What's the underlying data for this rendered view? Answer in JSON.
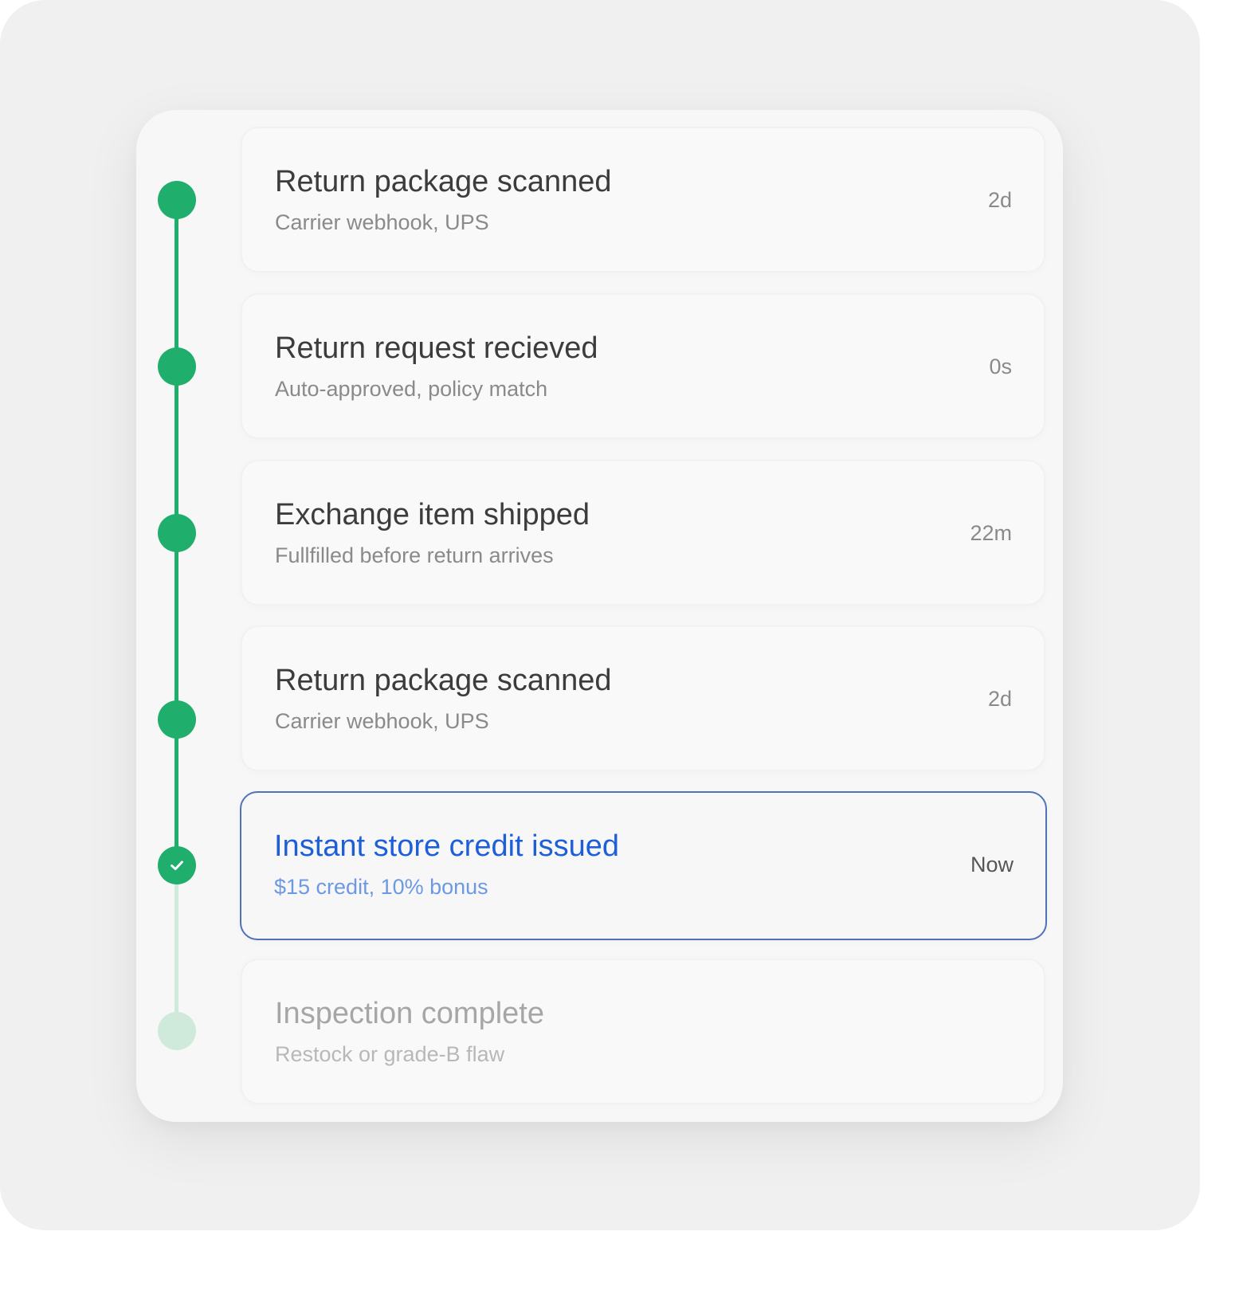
{
  "timeline": {
    "colors": {
      "complete": "#1fae6c",
      "pending": "#cfeadb",
      "active_border": "#4f72b8",
      "active_title": "#1e5fd8"
    },
    "events": [
      {
        "title": "Return package scanned",
        "subtitle": "Carrier webhook, UPS",
        "time": "2d",
        "status": "complete"
      },
      {
        "title": "Return request recieved",
        "subtitle": "Auto-approved, policy match",
        "time": "0s",
        "status": "complete"
      },
      {
        "title": "Exchange item shipped",
        "subtitle": "Fullfilled before return arrives",
        "time": "22m",
        "status": "complete"
      },
      {
        "title": "Return package scanned",
        "subtitle": "Carrier webhook, UPS",
        "time": "2d",
        "status": "complete"
      },
      {
        "title": "Instant store credit issued",
        "subtitle": "$15 credit, 10% bonus",
        "time": "Now",
        "status": "current",
        "icon": "check-icon"
      },
      {
        "title": "Inspection complete",
        "subtitle": "Restock or grade-B flaw",
        "time": "",
        "status": "pending"
      }
    ]
  }
}
